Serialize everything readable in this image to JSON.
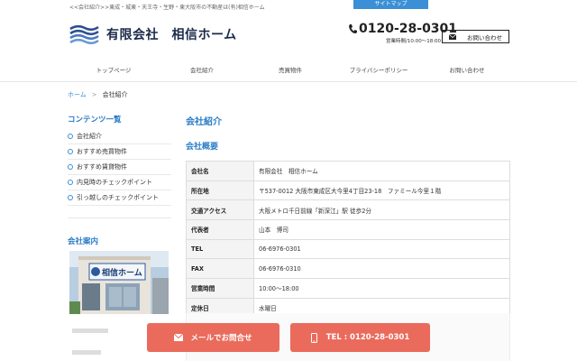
{
  "header": {
    "tagline": "<<会社紹介>>東成・城東・天王寺・生野・東大阪市の不動産は(有)相信ホーム",
    "sitemap_label": "サイトマップ",
    "logo_text": "有限会社　相信ホーム",
    "phone_number": "0120-28-0301",
    "hours": "営業時間/10:00〜18:00",
    "contact_label": "お問い合わせ"
  },
  "nav": {
    "items": [
      "トップページ",
      "会社紹介",
      "売買物件",
      "プライバシーポリシー",
      "お問い合わせ"
    ]
  },
  "breadcrumb": {
    "home": "ホーム",
    "separator": ">",
    "current": "会社紹介"
  },
  "sidebar": {
    "contents_title": "コンテンツ一覧",
    "items": [
      "会社紹介",
      "おすすめ売買物件",
      "おすすめ賃貸物件",
      "内見時のチェックポイント",
      "引っ越しのチェックポイント"
    ],
    "guide_title": "会社案内",
    "sign_text": "相信ホーム"
  },
  "main": {
    "title": "会社紹介",
    "subtitle": "会社概要",
    "table": [
      {
        "label": "会社名",
        "value": "有限会社　相信ホーム"
      },
      {
        "label": "所在地",
        "value": "〒537-0012 大阪市東成区大今里4丁目23-18　ファミール今里１階"
      },
      {
        "label": "交通アクセス",
        "value": "大阪メトロ千日前線「新深江」駅 徒歩2分"
      },
      {
        "label": "代表者",
        "value": "山本　博司"
      },
      {
        "label": "TEL",
        "value": "06-6976-0301"
      },
      {
        "label": "FAX",
        "value": "06-6976-0310"
      },
      {
        "label": "営業時間",
        "value": "10:00〜18:00"
      },
      {
        "label": "定休日",
        "value": "水曜日"
      }
    ]
  },
  "cta": {
    "mail_label": "メールでお問合せ",
    "tel_label": "TEL : 0120-28-0301"
  },
  "colors": {
    "accent": "#2a7cc7",
    "cta": "#ea6b5c",
    "sitemap": "#3a8fd6"
  }
}
